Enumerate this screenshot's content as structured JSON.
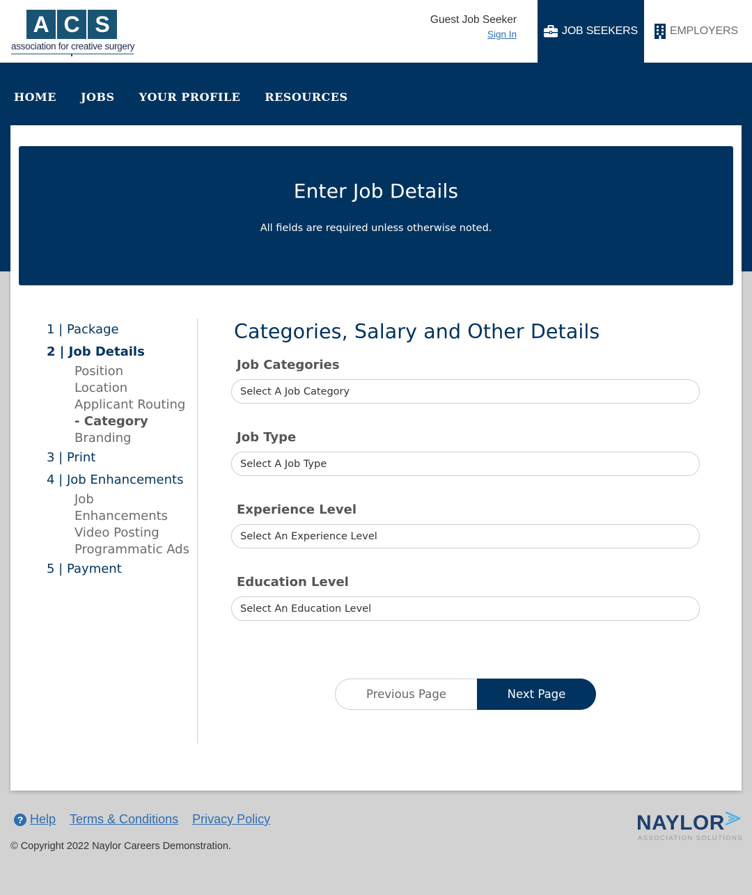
{
  "header": {
    "logo": {
      "letters": [
        "A",
        "C",
        "S"
      ],
      "tagline": "association for creative surgery"
    },
    "guest_name": "Guest Job Seeker",
    "sign_in": "Sign In",
    "role_tabs": {
      "seekers": "JOB SEEKERS",
      "employers": "EMPLOYERS"
    },
    "icons": {
      "seekers": "briefcase-icon",
      "employers": "building-icon"
    }
  },
  "nav": {
    "items": [
      "HOME",
      "JOBS",
      "YOUR PROFILE",
      "RESOURCES"
    ]
  },
  "hero": {
    "title": "Enter Job Details",
    "subtitle": "All fields are required unless otherwise noted."
  },
  "stepper": {
    "step1": "1 | Package",
    "step2": "2 | Job Details",
    "step2_subs": [
      "Position",
      "Location",
      "Applicant Routing",
      "- Category",
      "Branding"
    ],
    "step3": "3 | Print",
    "step4": "4 | Job Enhancements",
    "step4_subs": [
      "Job",
      "Enhancements",
      "Video Posting",
      "Programmatic Ads"
    ],
    "step5": "5 | Payment"
  },
  "form": {
    "title": "Categories, Salary and Other Details",
    "fields": [
      {
        "label": "Job Categories",
        "value": "Select A Job Category"
      },
      {
        "label": "Job Type",
        "value": "Select A Job Type"
      },
      {
        "label": "Experience Level",
        "value": "Select An Experience Level"
      },
      {
        "label": "Education Level",
        "value": "Select An Education Level"
      }
    ],
    "prev_label": "Previous Page",
    "next_label": "Next Page"
  },
  "footer": {
    "help": "Help",
    "terms": "Terms & Conditions",
    "privacy": "Privacy Policy",
    "copyright": "© Copyright 2022 Naylor Careers Demonstration.",
    "brand": "NAYLOR",
    "brand_sub": "ASSOCIATION SOLUTIONS"
  },
  "colors": {
    "brand_navy": "#00335f",
    "logo_blue": "#1a5475",
    "link_blue": "#2e6db4",
    "page_gray": "#d2d2d2"
  }
}
